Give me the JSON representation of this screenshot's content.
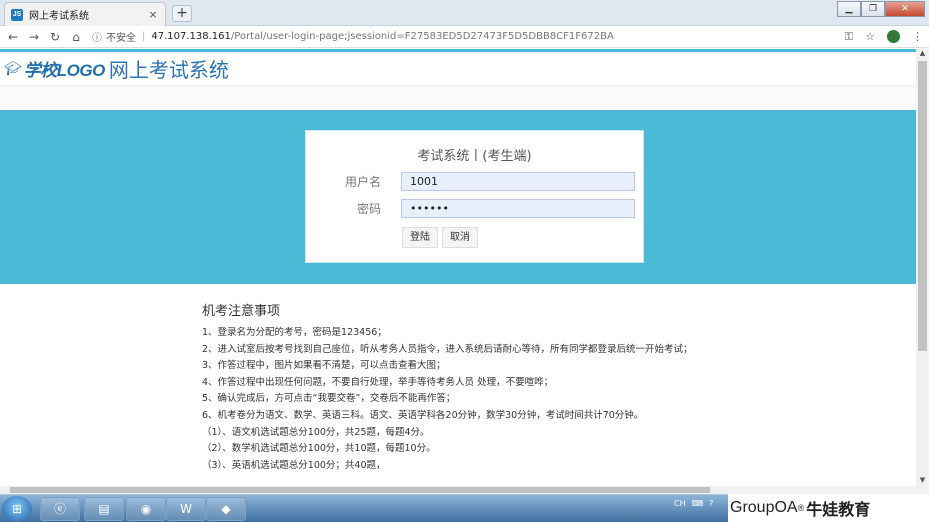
{
  "browser": {
    "tab_favicon": "JS",
    "tab_title": "网上考试系统",
    "tab_close": "×",
    "new_tab": "+",
    "insecure_label": "不安全",
    "url_host": "47.107.138.161",
    "url_path": "/Portal/user-login-page;jsessionid=F27583ED5D27473F5D5DBB8CF1F672BA",
    "profile_initial": "I",
    "icons": [
      "back-icon",
      "forward-icon",
      "reload-icon",
      "home-icon",
      "info-icon",
      "key-icon",
      "star-icon",
      "menu-icon"
    ]
  },
  "header": {
    "logo_text": "学校LOGO",
    "site_title": "网上考试系统"
  },
  "login": {
    "title": "考试系统丨(考生端)",
    "username_label": "用户名",
    "username_value": "1001",
    "password_label": "密码",
    "password_value": "••••••",
    "login_button": "登陆",
    "cancel_button": "取消"
  },
  "notice": {
    "title": "机考注意事项",
    "items": [
      "1、登录名为分配的考号，密码是123456；",
      "2、进入试室后按考号找到自己座位，听从考务人员指令，进入系统后请耐心等待，所有同学都登录后统一开始考试；",
      "3、作答过程中，图片如果看不清楚，可以点击查看大图；",
      "4、作答过程中出现任何问题，不要自行处理，举手等待考务人员 处理，不要喧哗；",
      "5、确认完成后，方可点击“我要交卷”，交卷后不能再作答；",
      "6、机考卷分为语文、数学、英语三科。语文、英语学科各20分钟，数学30分钟，考试时间共计70分钟。",
      "（1）、语文机选试题总分100分，共25题，每题4分。",
      "（2）、数学机选试题总分100分，共10题，每题10分。",
      "（3）、英语机选试题总分100分；共40题，"
    ]
  },
  "taskbar": {
    "tray_lang": "CH"
  },
  "watermark": {
    "brand": "GroupOA",
    "reg": "®",
    "cn": "牛娃教育"
  }
}
